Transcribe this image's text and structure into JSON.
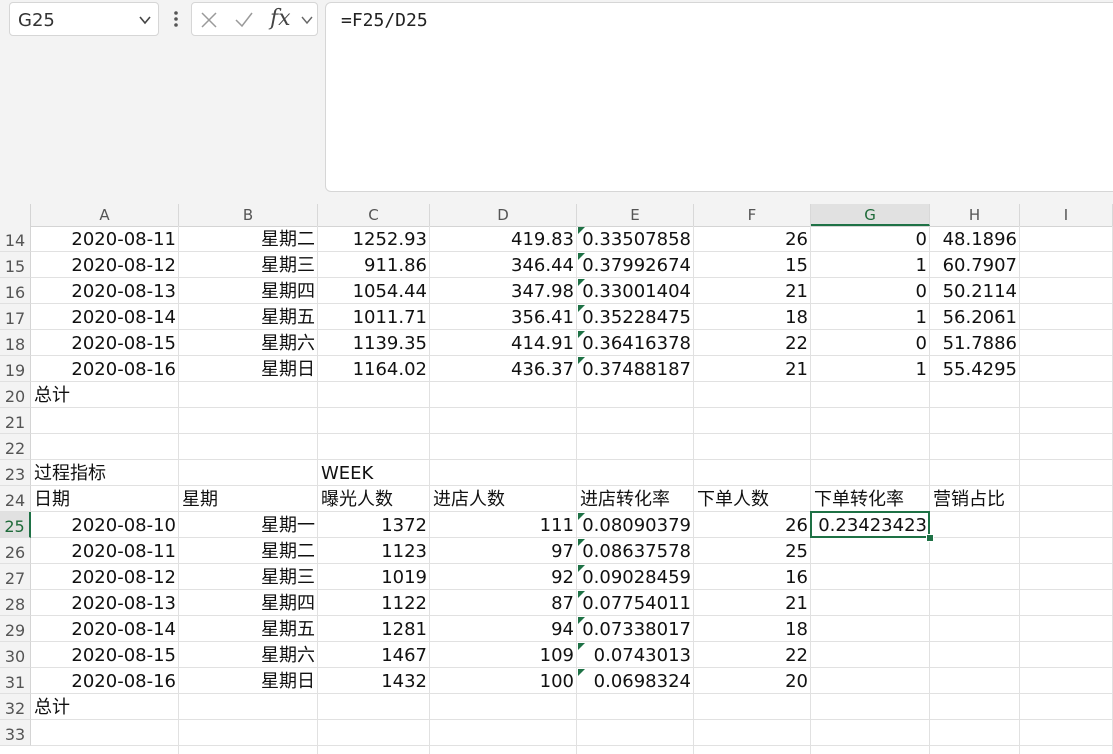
{
  "name_box": {
    "value": "G25"
  },
  "formula_bar": {
    "fx_label": "fx",
    "formula": "=F25/D25"
  },
  "columns": [
    "A",
    "B",
    "C",
    "D",
    "E",
    "F",
    "G",
    "H",
    "I"
  ],
  "selected_column": "G",
  "selected_row": "25",
  "rows": [
    {
      "num": "14",
      "A": "2020-08-11",
      "B": "星期二",
      "C": "1252.93",
      "D": "419.83",
      "E": "0.33507858",
      "F": "26",
      "G": "0",
      "H": "48.1896",
      "flag": true
    },
    {
      "num": "15",
      "A": "2020-08-12",
      "B": "星期三",
      "C": "911.86",
      "D": "346.44",
      "E": "0.37992674",
      "F": "15",
      "G": "1",
      "H": "60.7907",
      "flag": true
    },
    {
      "num": "16",
      "A": "2020-08-13",
      "B": "星期四",
      "C": "1054.44",
      "D": "347.98",
      "E": "0.33001404",
      "F": "21",
      "G": "0",
      "H": "50.2114",
      "flag": true
    },
    {
      "num": "17",
      "A": "2020-08-14",
      "B": "星期五",
      "C": "1011.71",
      "D": "356.41",
      "E": "0.35228475",
      "F": "18",
      "G": "1",
      "H": "56.2061",
      "flag": true
    },
    {
      "num": "18",
      "A": "2020-08-15",
      "B": "星期六",
      "C": "1139.35",
      "D": "414.91",
      "E": "0.36416378",
      "F": "22",
      "G": "0",
      "H": "51.7886",
      "flag": true
    },
    {
      "num": "19",
      "A": "2020-08-16",
      "B": "星期日",
      "C": "1164.02",
      "D": "436.37",
      "E": "0.37488187",
      "F": "21",
      "G": "1",
      "H": "55.4295",
      "flag": true
    },
    {
      "num": "20",
      "A": "总计",
      "left": true
    },
    {
      "num": "21"
    },
    {
      "num": "22"
    },
    {
      "num": "23",
      "A": "过程指标",
      "C": "WEEK",
      "left": true
    },
    {
      "num": "24",
      "A": "日期",
      "B": "星期",
      "C": "曝光人数",
      "D": "进店人数",
      "E": "进店转化率",
      "F": "下单人数",
      "G": "下单转化率",
      "H": "营销占比",
      "left": true
    },
    {
      "num": "25",
      "A": "2020-08-10",
      "B": "星期一",
      "C": "1372",
      "D": "111",
      "E": "0.08090379",
      "F": "26",
      "G": "0.23423423",
      "flag": true
    },
    {
      "num": "26",
      "A": "2020-08-11",
      "B": "星期二",
      "C": "1123",
      "D": "97",
      "E": "0.08637578",
      "F": "25",
      "flag": true
    },
    {
      "num": "27",
      "A": "2020-08-12",
      "B": "星期三",
      "C": "1019",
      "D": "92",
      "E": "0.09028459",
      "F": "16",
      "flag": true
    },
    {
      "num": "28",
      "A": "2020-08-13",
      "B": "星期四",
      "C": "1122",
      "D": "87",
      "E": "0.07754011",
      "F": "21",
      "flag": true
    },
    {
      "num": "29",
      "A": "2020-08-14",
      "B": "星期五",
      "C": "1281",
      "D": "94",
      "E": "0.07338017",
      "F": "18",
      "flag": true
    },
    {
      "num": "30",
      "A": "2020-08-15",
      "B": "星期六",
      "C": "1467",
      "D": "109",
      "E": "0.0743013",
      "F": "22",
      "flag": true
    },
    {
      "num": "31",
      "A": "2020-08-16",
      "B": "星期日",
      "C": "1432",
      "D": "100",
      "E": "0.0698324",
      "F": "20",
      "flag": true
    },
    {
      "num": "32",
      "A": "总计",
      "left": true
    },
    {
      "num": "33"
    }
  ],
  "colors": {
    "accent": "#1e7145",
    "flag_triangle": "#1e7145"
  }
}
